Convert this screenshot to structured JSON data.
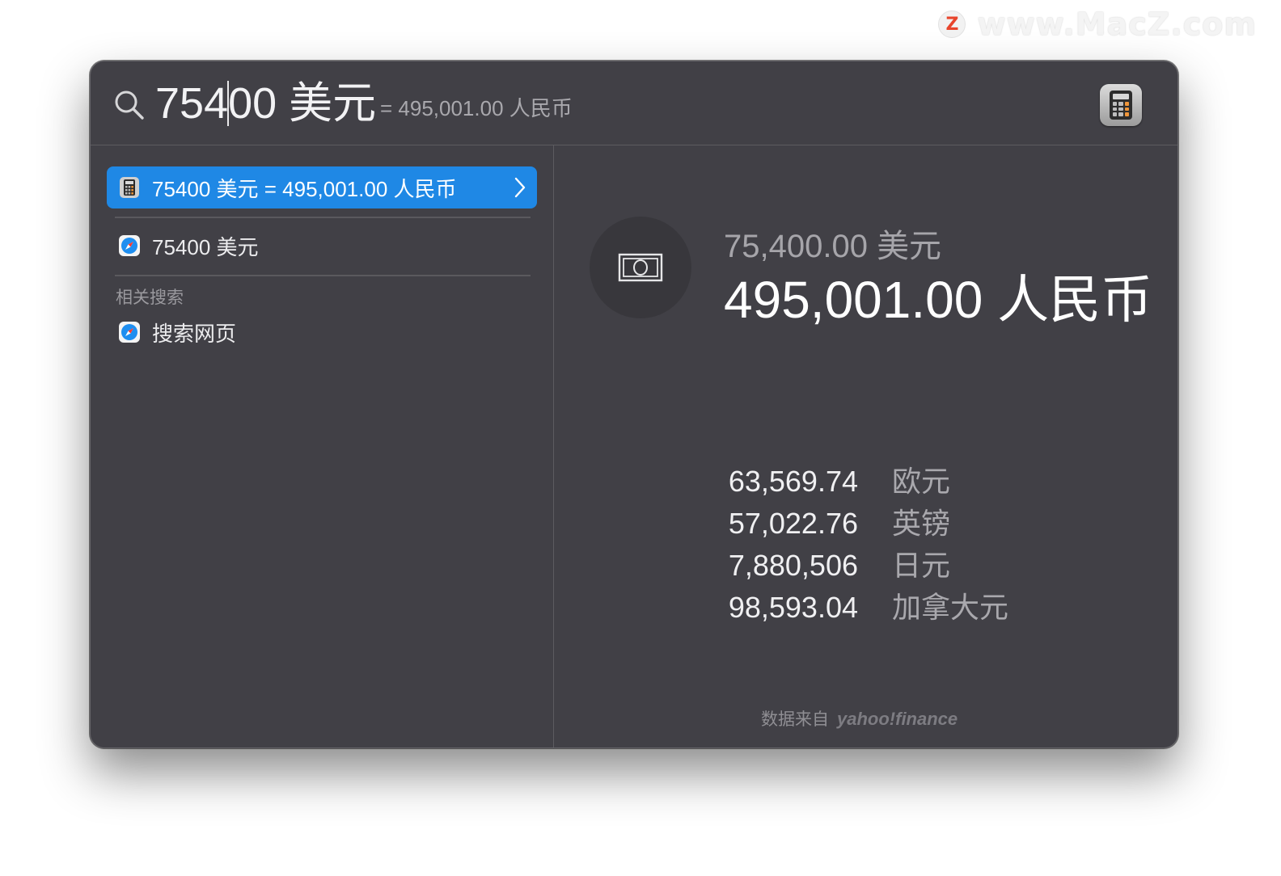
{
  "watermark": {
    "text": "www.MacZ.com",
    "logo_letter": "Z"
  },
  "search": {
    "query_before_caret": "754",
    "query_after_caret": "00 美元",
    "hint": "= 495,001.00 人民币"
  },
  "results": [
    {
      "label": "75400 美元 = 495,001.00 人民币",
      "icon": "calculator-icon",
      "selected": true
    },
    {
      "label": "75400 美元",
      "icon": "safari-icon",
      "selected": false
    }
  ],
  "related": {
    "section_label": "相关搜索",
    "items": [
      {
        "label": "搜索网页",
        "icon": "safari-icon"
      }
    ]
  },
  "preview": {
    "icon": "banknote-icon",
    "from_amount": "75,400.00 美元",
    "to_amount": "495,001.00 人民币",
    "rates": [
      {
        "value": "63,569.74",
        "currency": "欧元"
      },
      {
        "value": "57,022.76",
        "currency": "英镑"
      },
      {
        "value": "7,880,506",
        "currency": "日元"
      },
      {
        "value": "98,593.04",
        "currency": "加拿大元"
      }
    ],
    "source_text": "数据来自",
    "source_brand": "yahoo!finance"
  },
  "colors": {
    "window_bg": "#414046",
    "selection": "#1f88e5",
    "watermark_accent": "#e8452c"
  }
}
